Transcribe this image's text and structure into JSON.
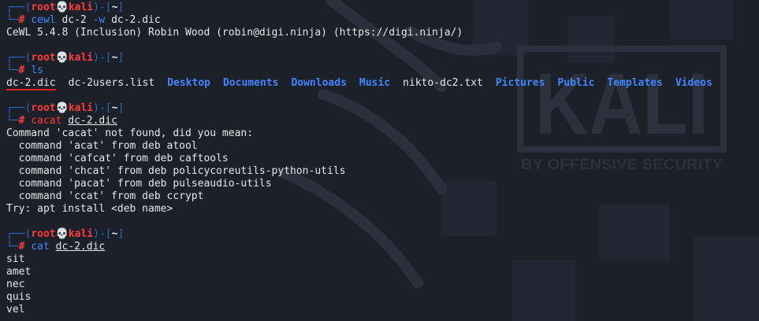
{
  "prompt": {
    "top_left": "┌──(",
    "user": "root",
    "skull": "💀",
    "host": "kali",
    "mid": ")-[",
    "cwd": "~",
    "end": "]",
    "bottom_left": "└─",
    "hash": "#"
  },
  "blocks": [
    {
      "command": "cewl",
      "command_valid": true,
      "args": [
        {
          "text": "dc-2",
          "type": "plain"
        },
        {
          "text": "-w",
          "type": "option"
        },
        {
          "text": "dc-2.dic",
          "type": "plain"
        }
      ],
      "output": [
        "CeWL 5.4.8 (Inclusion) Robin Wood (robin@digi.ninja) (https://digi.ninja/)"
      ]
    },
    {
      "command": "ls",
      "command_valid": true,
      "args": [],
      "ls_items": [
        {
          "name": "dc-2.dic",
          "type": "file",
          "selected": true
        },
        {
          "name": "dc-2users.list",
          "type": "file"
        },
        {
          "name": "Desktop",
          "type": "dir"
        },
        {
          "name": "Documents",
          "type": "dir"
        },
        {
          "name": "Downloads",
          "type": "dir"
        },
        {
          "name": "Music",
          "type": "dir"
        },
        {
          "name": "nikto-dc2.txt",
          "type": "file"
        },
        {
          "name": "Pictures",
          "type": "dir"
        },
        {
          "name": "Public",
          "type": "dir"
        },
        {
          "name": "Templates",
          "type": "dir"
        },
        {
          "name": "Videos",
          "type": "dir"
        }
      ]
    },
    {
      "command": "cacat",
      "command_valid": false,
      "args": [
        {
          "text": "dc-2.dic",
          "type": "path"
        }
      ],
      "output": [
        "Command 'cacat' not found, did you mean:",
        "  command 'acat' from deb atool",
        "  command 'cafcat' from deb caftools",
        "  command 'chcat' from deb policycoreutils-python-utils",
        "  command 'pacat' from deb pulseaudio-utils",
        "  command 'ccat' from deb ccrypt",
        "Try: apt install <deb name>",
        ""
      ]
    },
    {
      "command": "cat",
      "command_valid": true,
      "args": [
        {
          "text": "dc-2.dic",
          "type": "path"
        }
      ],
      "output": [
        "sit",
        "amet",
        "nec",
        "quis",
        "vel"
      ]
    }
  ],
  "watermark": {
    "brand": "KALI",
    "tagline": "BY OFFENSIVE SECURITY"
  },
  "colors": {
    "background": "#1c2029",
    "frame": "#2f66c9",
    "user": "#ff3b3b",
    "directory": "#3f86ff",
    "text": "#e6e6e6",
    "selection_underline": "#e02020"
  }
}
